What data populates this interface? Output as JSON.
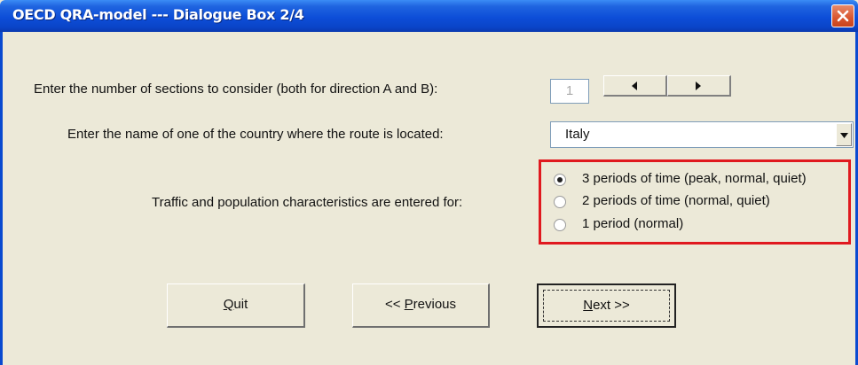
{
  "window": {
    "title": "OECD QRA-model --- Dialogue Box 2/4"
  },
  "sections": {
    "label": "Enter the number of sections to consider (both for direction A and B):",
    "value": "1"
  },
  "country": {
    "label": "Enter the name of one of the country where the route is located:",
    "selected": "Italy"
  },
  "traffic": {
    "label": "Traffic and population characteristics are entered for:",
    "options": [
      {
        "label": "3 periods of time (peak, normal, quiet)",
        "checked": true
      },
      {
        "label": "2 periods of time (normal, quiet)",
        "checked": false
      },
      {
        "label": "1 period (normal)",
        "checked": false
      }
    ]
  },
  "buttons": {
    "quit": {
      "accel": "Q",
      "rest": "uit"
    },
    "previous": {
      "pre": "<< ",
      "accel": "P",
      "rest": "revious"
    },
    "next": {
      "accel": "N",
      "rest": "ext >>"
    }
  }
}
